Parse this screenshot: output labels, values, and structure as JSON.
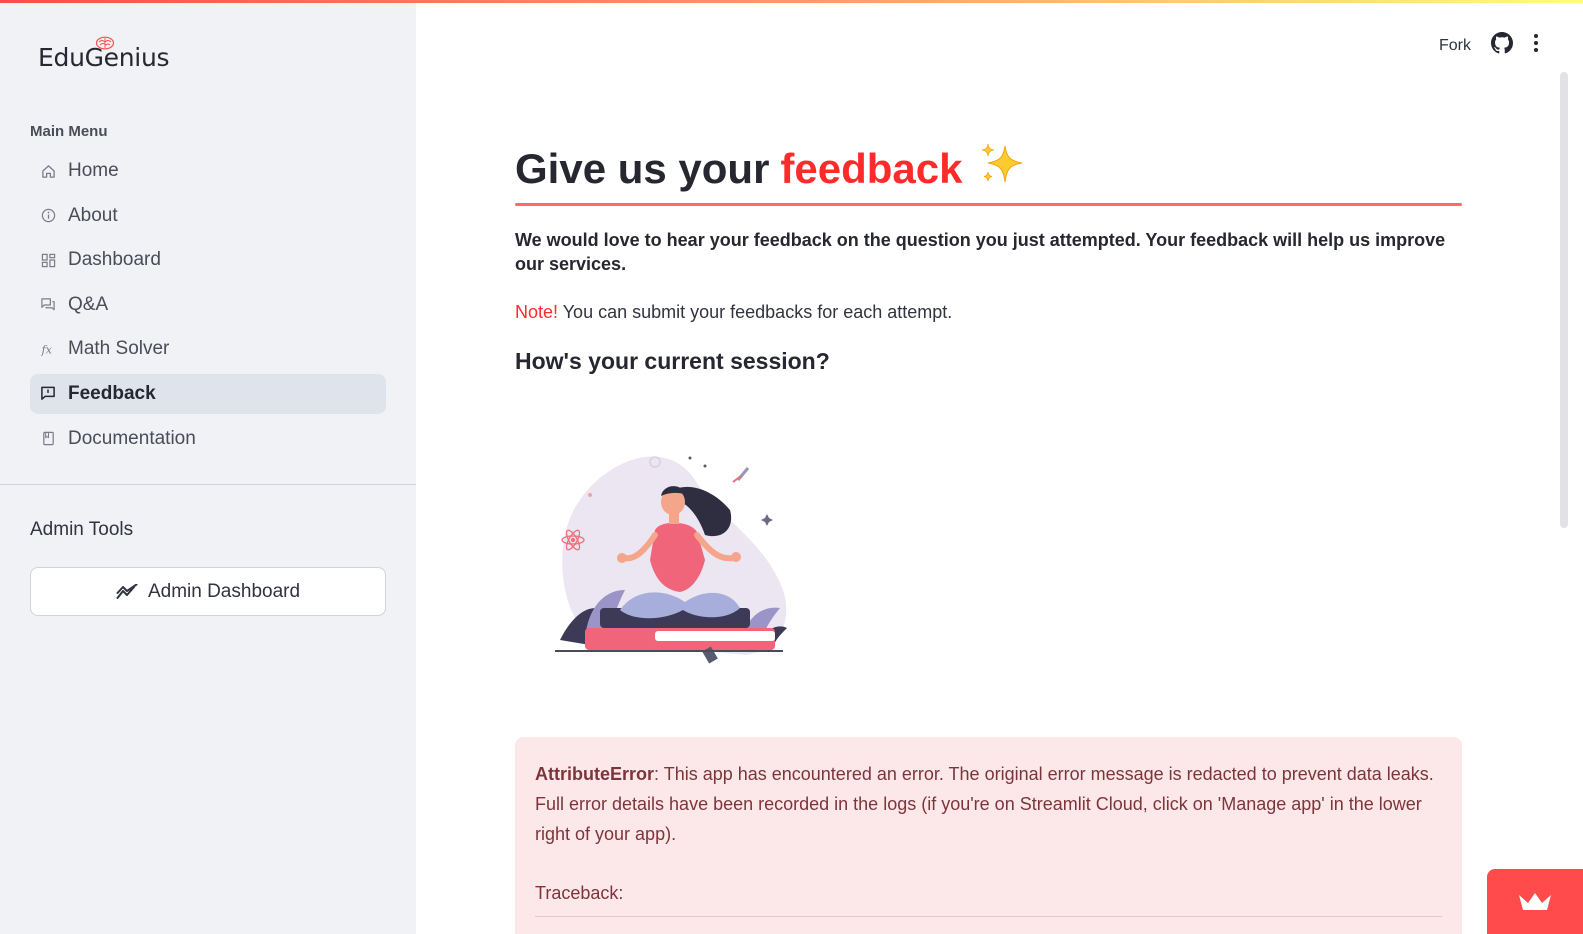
{
  "app": {
    "logo_text": "EduGenius"
  },
  "sidebar": {
    "menu_title": "Main Menu",
    "items": [
      {
        "label": "Home",
        "icon": "home-icon"
      },
      {
        "label": "About",
        "icon": "info-circle-icon"
      },
      {
        "label": "Dashboard",
        "icon": "dashboard-grid-icon"
      },
      {
        "label": "Q&A",
        "icon": "chat-bubbles-icon"
      },
      {
        "label": "Math Solver",
        "icon": "function-icon"
      },
      {
        "label": "Feedback",
        "icon": "feedback-message-icon",
        "active": true
      },
      {
        "label": "Documentation",
        "icon": "book-icon"
      }
    ],
    "admin_title": "Admin Tools",
    "admin_button_label": "Admin Dashboard",
    "admin_button_icon": "trend-chart-icon"
  },
  "header": {
    "fork_label": "Fork",
    "github_icon": "github-icon",
    "menu_icon": "kebab-menu-icon"
  },
  "main": {
    "title_prefix": "Give us your",
    "title_accent": "feedback",
    "title_emoji": "✨",
    "intro": "We would love to hear your feedback on the question you just attempted. Your feedback will help us improve our services.",
    "note_key": "Note!",
    "note_text": " You can submit your feedbacks for each attempt.",
    "session_heading": "How's your current session?",
    "illustration": "meditating-woman-on-books-illustration"
  },
  "error": {
    "type": "AttributeError",
    "message": ": This app has encountered an error. The original error message is redacted to prevent data leaks. Full error details have been recorded in the logs (if you're on Streamlit Cloud, click on 'Manage app' in the lower right of your app).",
    "traceback_label": "Traceback:"
  },
  "colors": {
    "accent": "#ff2b2b",
    "sidebar_bg": "#f0f2f6",
    "active_item_bg": "#dfe3eb",
    "error_bg": "#fde8e9",
    "error_text": "#7d353b"
  }
}
